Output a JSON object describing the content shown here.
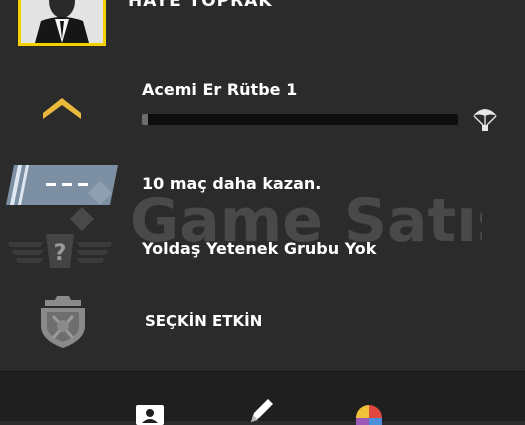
{
  "player": {
    "name": "HAYE TOPRAK"
  },
  "rank": {
    "label": "Acemi Er Rütbe 1",
    "progress": 0.02
  },
  "wins": {
    "label": "10 maç daha kazan."
  },
  "skill_group": {
    "label": "Yoldaş Yetenek Grubu Yok",
    "badge_text": "?"
  },
  "elite": {
    "label": "SEÇKİN ETKİN"
  },
  "watermark": {
    "text": "Game Satış"
  },
  "colors": {
    "avatar_border": "#f2d200",
    "rank_chevron": "#e9b93b",
    "background": "#2b2b2b",
    "bottom_bar": "#1f1f1f"
  },
  "bottom_bar": {
    "icons": [
      "profile-icon",
      "pencil-icon",
      "color-palette-icon"
    ]
  }
}
